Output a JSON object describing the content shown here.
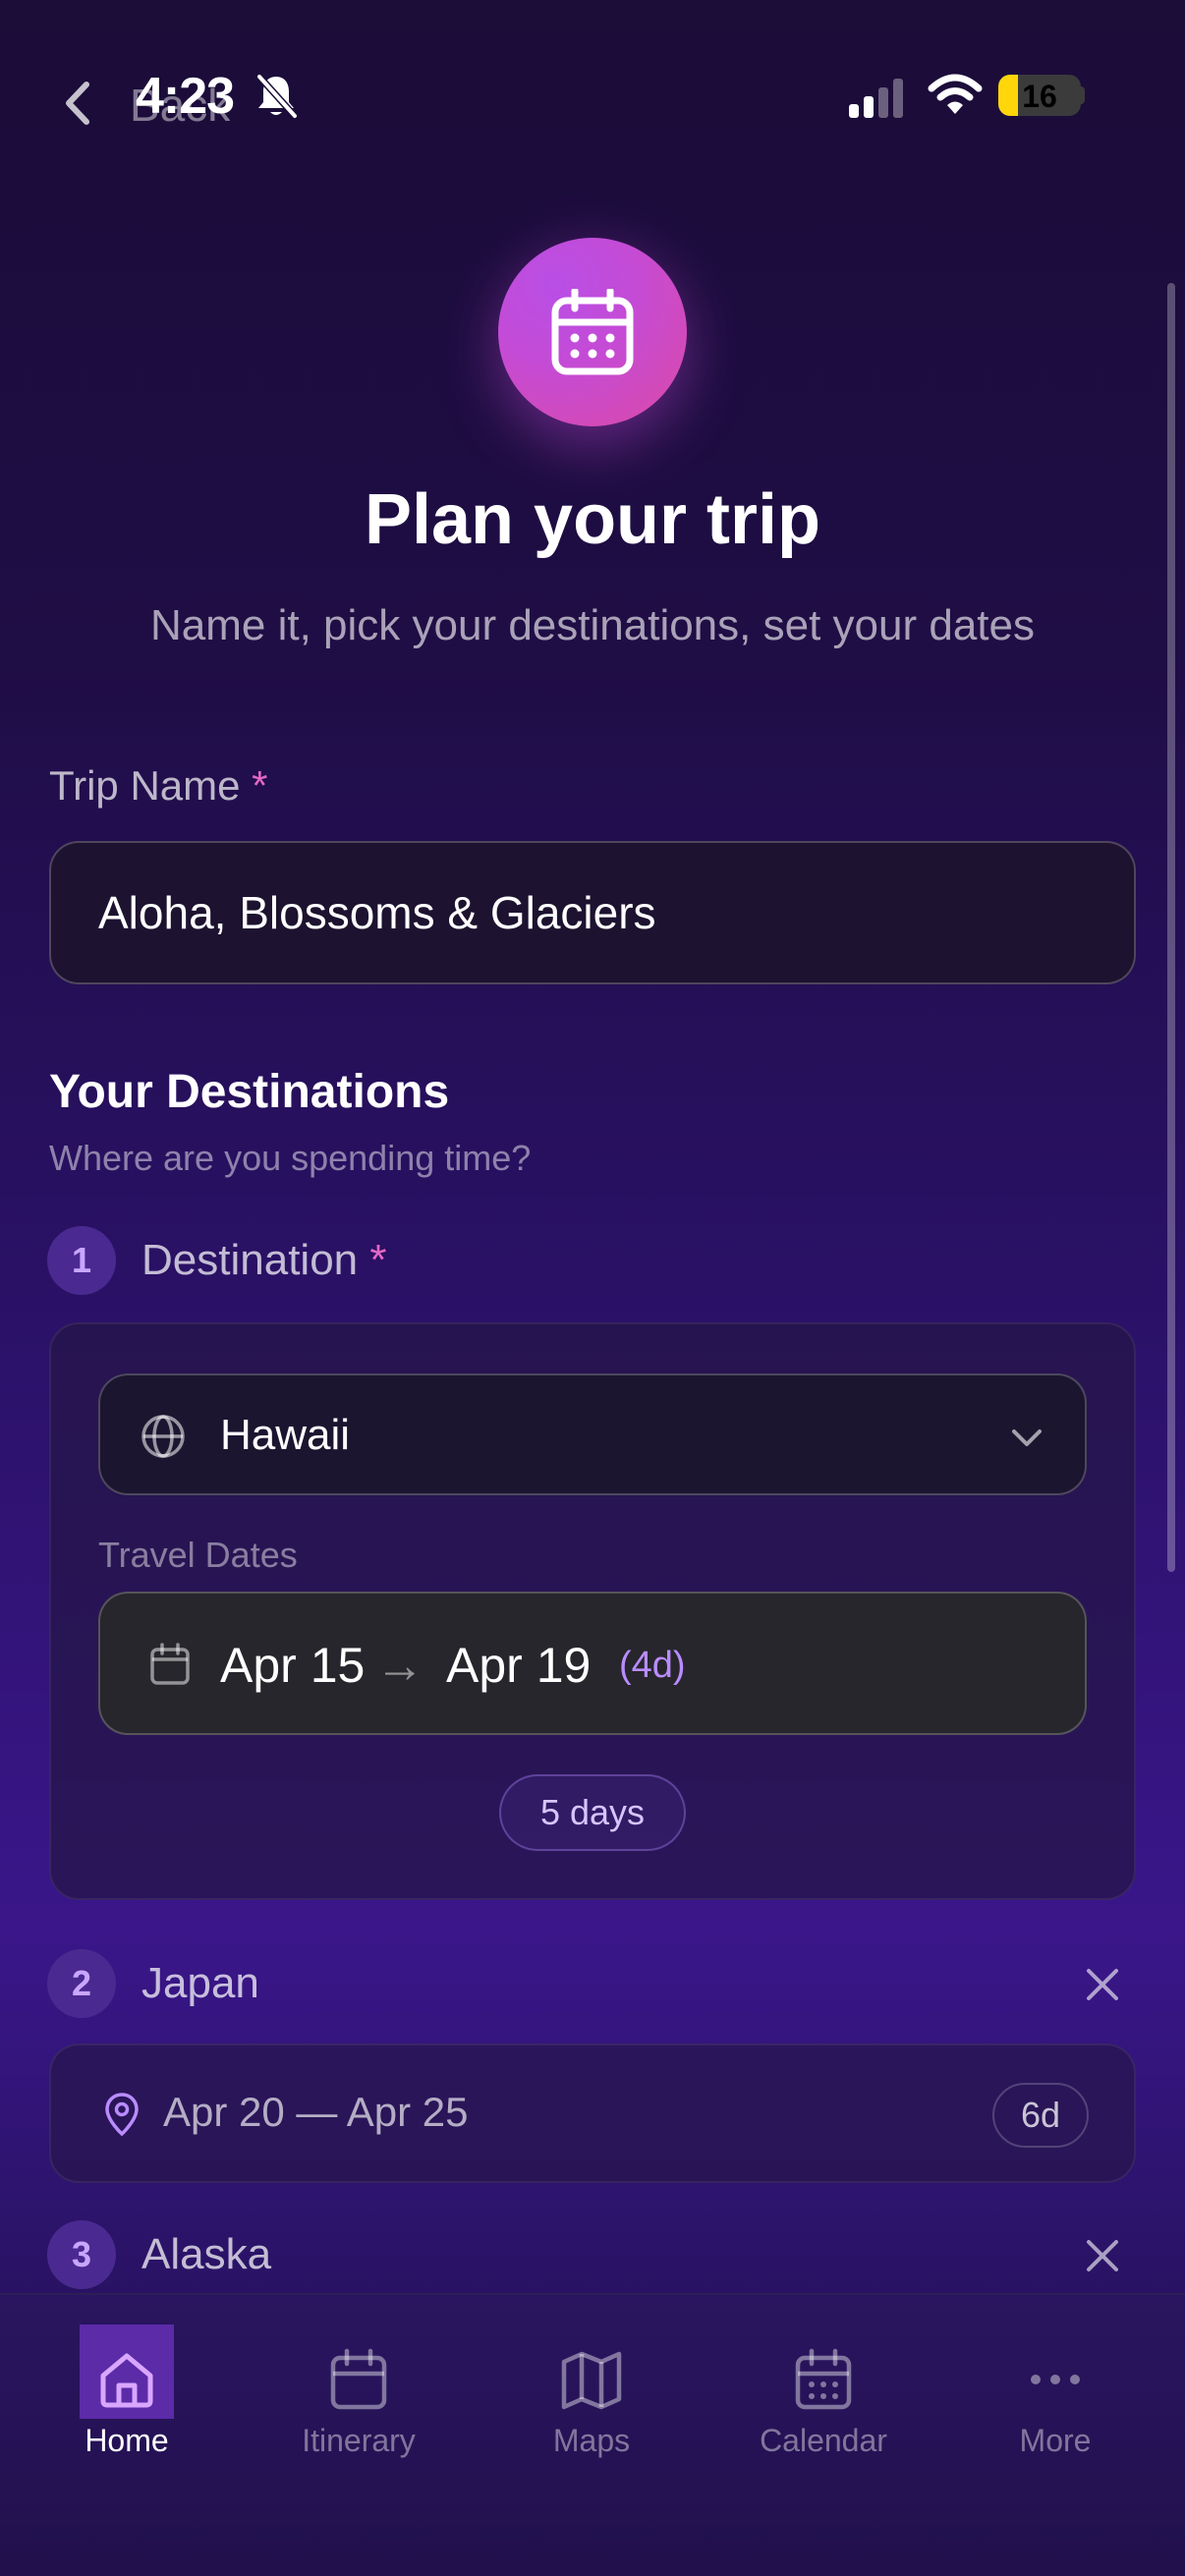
{
  "status_bar": {
    "time": "4:23",
    "battery": "16",
    "back_label": "Back"
  },
  "header": {
    "icon": "calendar-icon",
    "title": "Plan your trip",
    "subtitle": "Name it, pick your destinations, set your dates"
  },
  "trip_name": {
    "label": "Trip Name",
    "required_mark": "*",
    "value": "Aloha, Blossoms & Glaciers"
  },
  "destinations_section": {
    "title": "Your Destinations",
    "subtitle": "Where are you spending time?",
    "items": [
      {
        "number": "1",
        "label": "Destination",
        "required_mark": "*",
        "selected": "Hawaii",
        "travel_dates_label": "Travel Dates",
        "start": "Apr 15",
        "arrow": "→",
        "end": "Apr 19",
        "duration": "(4d)",
        "days_pill": "5 days"
      },
      {
        "number": "2",
        "name": "Japan",
        "range": "Apr 20 — Apr 25",
        "days": "6d"
      },
      {
        "number": "3",
        "name": "Alaska"
      }
    ]
  },
  "tabs": [
    {
      "label": "Home",
      "icon": "home-icon",
      "active": true
    },
    {
      "label": "Itinerary",
      "icon": "calendar-icon"
    },
    {
      "label": "Maps",
      "icon": "map-icon"
    },
    {
      "label": "Calendar",
      "icon": "calendar-grid-icon"
    },
    {
      "label": "More",
      "icon": "more-dots-icon"
    }
  ],
  "colors": {
    "accent": "#c44bd6",
    "required": "#e468c6",
    "duration": "#b98cff"
  }
}
